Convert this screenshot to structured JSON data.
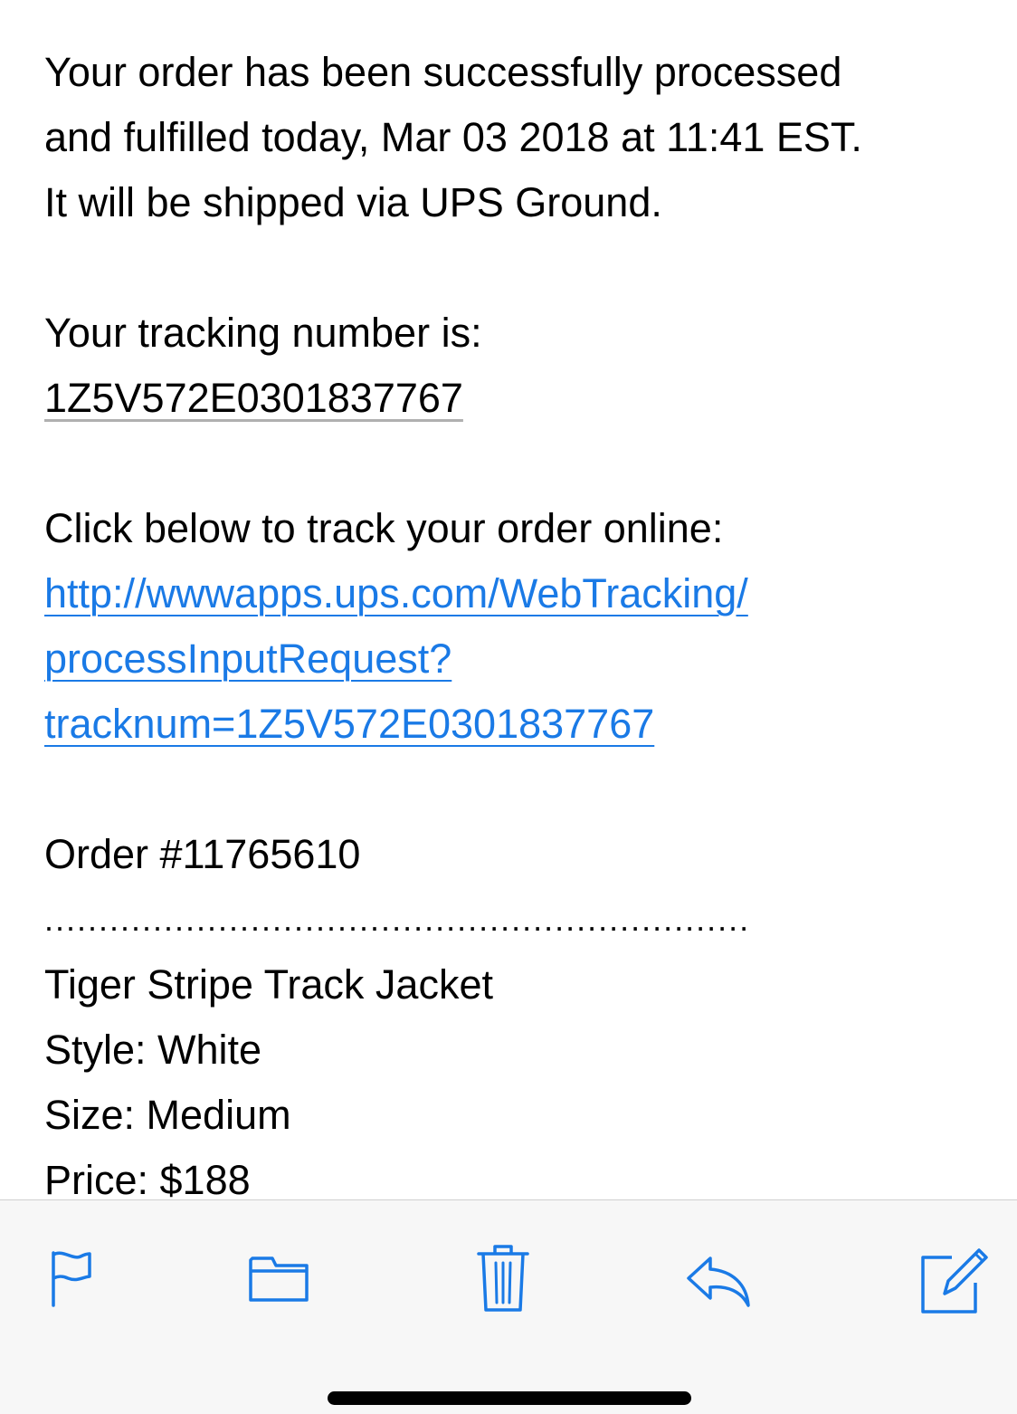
{
  "email": {
    "intro_lines": [
      "Your order has been successfully processed",
      "and fulfilled today, Mar 03 2018 at 11:41 EST.",
      "It will be shipped via UPS Ground."
    ],
    "tracking_label": "Your tracking number is:",
    "tracking_number": "1Z5V572E0301837767",
    "track_online_label": "Click below to track your order online:",
    "tracking_link_lines": [
      "http://wwwapps.ups.com/WebTracking/",
      "processInputRequest?",
      "tracknum=1Z5V572E0301837767"
    ],
    "order_number": "Order #11765610",
    "separator": ".................................................................",
    "item": {
      "name": "Tiger Stripe Track Jacket",
      "style": "Style: White",
      "size": "Size: Medium",
      "price": "Price: $188"
    }
  },
  "toolbar": {
    "accent_color": "#1a7ae6",
    "icons": [
      "flag-icon",
      "folder-icon",
      "trash-icon",
      "reply-icon",
      "compose-icon"
    ]
  }
}
